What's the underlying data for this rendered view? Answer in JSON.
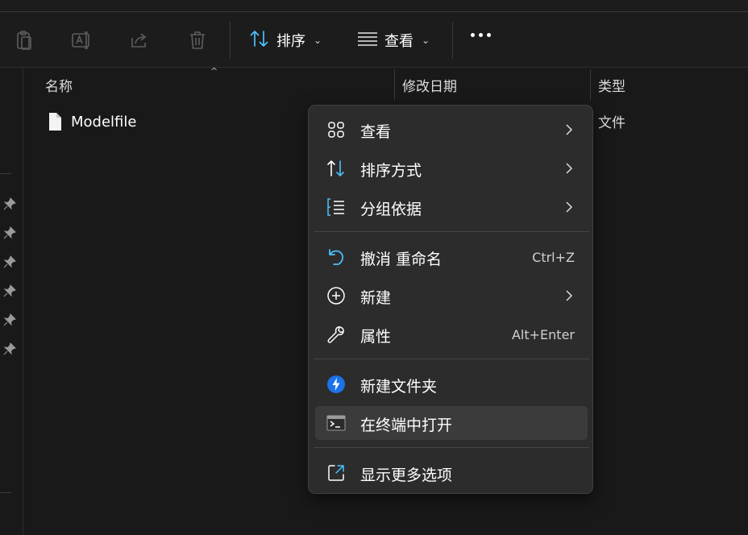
{
  "toolbar": {
    "sort_label": "排序",
    "view_label": "查看"
  },
  "columns": {
    "name": "名称",
    "modified": "修改日期",
    "type": "类型"
  },
  "file": {
    "name": "Modelfile",
    "type": "文件"
  },
  "context_menu": {
    "view": "查看",
    "sort_by": "排序方式",
    "group_by": "分组依据",
    "undo_rename": "撤消 重命名",
    "undo_shortcut": "Ctrl+Z",
    "new": "新建",
    "properties": "属性",
    "properties_shortcut": "Alt+Enter",
    "new_folder": "新建文件夹",
    "open_in_terminal": "在终端中打开",
    "show_more_options": "显示更多选项"
  },
  "colors": {
    "accent": "#4cc2ff",
    "background": "#191919",
    "menu_bg": "#2c2c2c"
  }
}
